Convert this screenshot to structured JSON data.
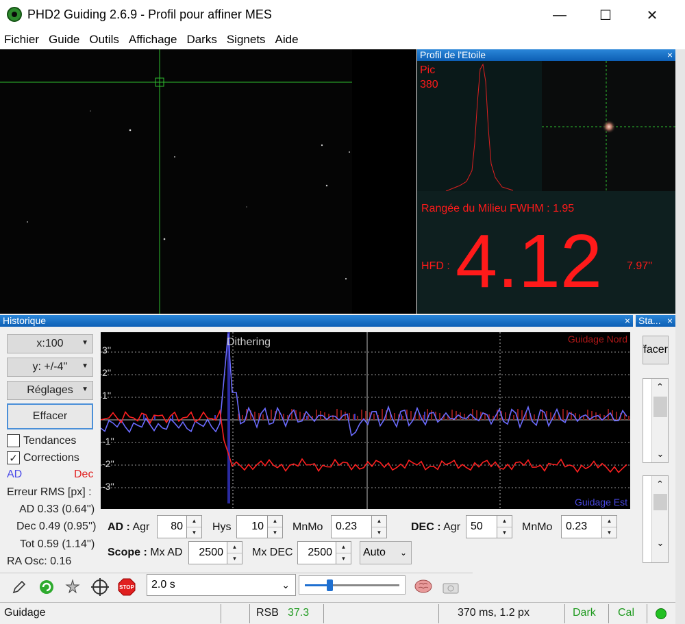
{
  "window": {
    "title": "PHD2 Guiding 2.6.9 - Profil pour affiner MES",
    "minimize": "—",
    "maximize": "☐",
    "close": "✕"
  },
  "menu": [
    "Fichier",
    "Guide",
    "Outils",
    "Affichage",
    "Darks",
    "Signets",
    "Aide"
  ],
  "profile": {
    "header": "Profil de l'Etoile",
    "close": "×",
    "peak_label": "Pic",
    "peak_value": "380",
    "fwhm": "Rangée du Milieu FWHM : 1.95",
    "hfd_label": "HFD :",
    "hfd_value": "4.12",
    "hfd_arcsec": "7.97''"
  },
  "history": {
    "header": "Historique",
    "close": "×",
    "x_scale": "x:100",
    "y_scale": "y: +/-4''",
    "settings": "Réglages",
    "clear": "Effacer",
    "trends": "Tendances",
    "corrections": "Corrections",
    "corrections_checked": true,
    "legend_ra": "AD",
    "legend_dec": "Dec",
    "rms_title": "Erreur RMS [px] :",
    "rms_ra": "AD 0.33 (0.64'')",
    "rms_dec": "Dec 0.49 (0.95'')",
    "rms_tot": "Tot 0.59 (1.14'')",
    "ra_osc": "RA Osc: 0.16",
    "colors": {
      "ra": "#6666ff",
      "dec": "#ff2020"
    }
  },
  "graph": {
    "label_north": "Guidage Nord",
    "label_east": "Guidage Est",
    "dithering": "Dithering",
    "y_ticks": [
      "3''",
      "2''",
      "1''",
      "-1''",
      "-2''",
      "-3''"
    ]
  },
  "controls": {
    "ra_label": "AD :",
    "agr": "Agr",
    "ra_agr": "80",
    "hys": "Hys",
    "ra_hys": "10",
    "mnmo": "MnMo",
    "ra_mnmo": "0.23",
    "dec_label": "DEC :",
    "dec_agr": "50",
    "dec_mnmo": "0.23",
    "scope_label": "Scope :",
    "mx_ad": "Mx AD",
    "mx_ad_val": "2500",
    "mx_dec": "Mx DEC",
    "mx_dec_val": "2500",
    "dec_mode": "Auto"
  },
  "stats": {
    "header": "Sta...",
    "close": "×",
    "clear": "ffacer"
  },
  "toolbar": {
    "exposure": "2.0 s",
    "icons": [
      "pencil-icon",
      "loop-icon",
      "star-icon",
      "crosshair-icon",
      "stop-icon",
      "brain-icon",
      "camera-icon"
    ]
  },
  "status": {
    "state": "Guidage",
    "snr_label": "RSB",
    "snr_value": "37.3",
    "timing": "370 ms, 1.2 px",
    "dark": "Dark",
    "cal": "Cal"
  }
}
